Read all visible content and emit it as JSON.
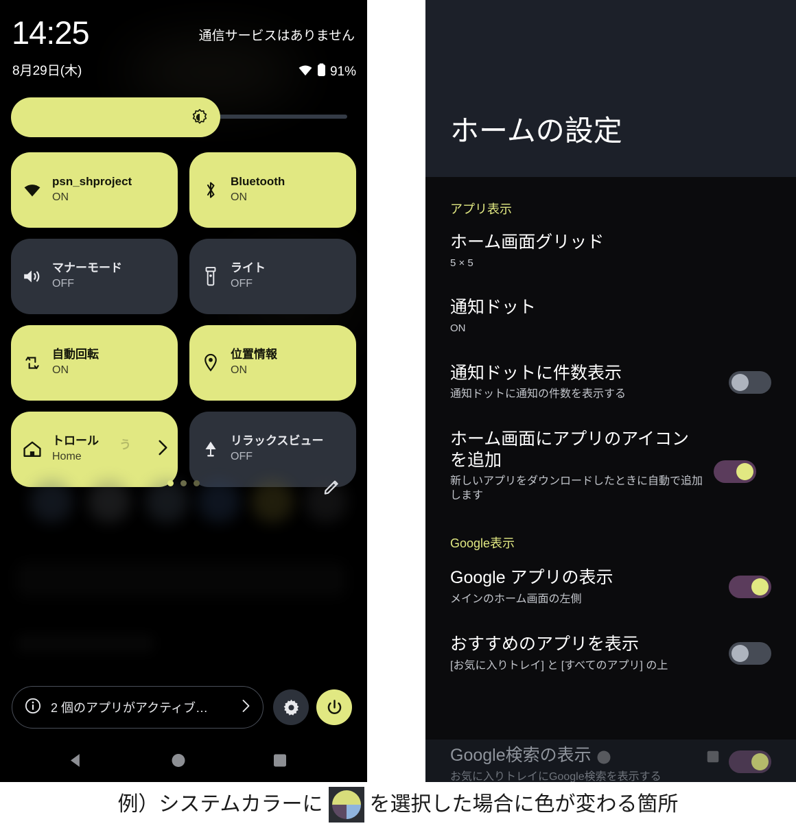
{
  "colors": {
    "accent_yellow": "#E1E882",
    "tile_off": "#2D323B",
    "switch_on_track": "#5B3C5C",
    "switch_off_track": "#464B55",
    "switch_off_knob": "#AEB4BE",
    "header_bar": "#1C2029",
    "swatch_top": "#D8DD7B",
    "swatch_bottom_left": "#5D4A63",
    "swatch_bottom_right": "#8FB4DE"
  },
  "quick_settings": {
    "status": {
      "clock": "14:25",
      "date": "8月29日(木)",
      "carrier": "通信サービスはありません",
      "battery": "91%",
      "wifi_icon": "wifi-icon",
      "battery_icon": "battery-icon"
    },
    "brightness": {
      "icon": "brightness-icon",
      "fill_percent": 61
    },
    "tiles": [
      {
        "title": "psn_shproject",
        "sub": "ON",
        "state": "on",
        "icon": "wifi-icon"
      },
      {
        "title": "Bluetooth",
        "sub": "ON",
        "state": "on",
        "icon": "bluetooth-icon"
      },
      {
        "title": "マナーモード",
        "sub": "OFF",
        "state": "off",
        "icon": "volume-icon"
      },
      {
        "title": "ライト",
        "sub": "OFF",
        "state": "off",
        "icon": "flashlight-icon"
      },
      {
        "title": "自動回転",
        "sub": "ON",
        "state": "on",
        "icon": "auto-rotate-icon"
      },
      {
        "title": "位置情報",
        "sub": "ON",
        "state": "on",
        "icon": "location-pin-icon"
      },
      {
        "title": "トロール",
        "sub": "Home",
        "state": "on",
        "icon": "home-icon",
        "ghost": "う",
        "chevron": true
      },
      {
        "title": "リラックスビュー",
        "sub": "OFF",
        "state": "off",
        "icon": "lamp-icon"
      }
    ],
    "pager": {
      "dots": 3,
      "active_index": 0
    },
    "edit_icon": "pencil-icon",
    "footer": {
      "info_icon": "info-icon",
      "active_apps_label": "2 個のアプリがアクティブ…",
      "chevron_icon": "chevron-right-icon",
      "settings_icon": "gear-icon",
      "power_icon": "power-icon"
    },
    "navbar": {
      "back_icon": "back-triangle-icon",
      "home_icon": "home-circle-icon",
      "recents_icon": "recents-square-icon"
    }
  },
  "home_settings": {
    "title": "ホームの設定",
    "sections": [
      {
        "header": "アプリ表示",
        "rows": [
          {
            "title": "ホーム画面グリッド",
            "sub": "5 × 5",
            "control": "none"
          },
          {
            "title": "通知ドット",
            "sub": "ON",
            "control": "none"
          },
          {
            "title": "通知ドットに件数表示",
            "sub": "通知ドットに通知の件数を表示する",
            "control": "switch",
            "state": "off"
          },
          {
            "title": "ホーム画面にアプリのアイコンを追加",
            "sub": "新しいアプリをダウンロードしたときに自動で追加します",
            "control": "switch",
            "state": "on"
          }
        ]
      },
      {
        "header": "Google表示",
        "rows": [
          {
            "title": "Google アプリの表示",
            "sub": "メインのホーム画面の左側",
            "control": "switch",
            "state": "on"
          },
          {
            "title": "おすすめのアプリを表示",
            "sub": "[お気に入りトレイ] と [すべてのアプリ] の上",
            "control": "switch",
            "state": "off"
          }
        ]
      }
    ],
    "partial_row": {
      "title": "Google検索の表示",
      "sub": "お気に入りトレイにGoogle検索を表示する",
      "control": "switch",
      "state": "on"
    }
  },
  "caption": {
    "before": "例）システムカラーに",
    "swatch_icon": "color-swatch-icon",
    "after": "を選択した場合に色が変わる箇所"
  }
}
